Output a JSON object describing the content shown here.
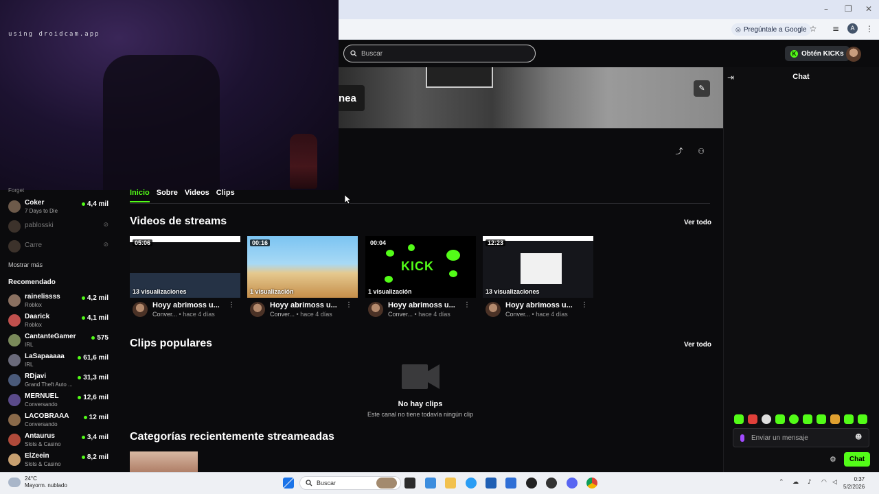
{
  "browser": {
    "ask_google": "Pregúntale a Google",
    "profile_initial": "A"
  },
  "header": {
    "search_placeholder": "Buscar",
    "get_kicks": "Obtén KICKs"
  },
  "banner": {
    "label_fragment": "nea"
  },
  "webcam": {
    "overlay_text": "using droidcam.app"
  },
  "chat": {
    "title": "Chat",
    "input_placeholder": "Enviar un mensaje",
    "send_label": "Chat"
  },
  "sidebar": {
    "partial_top": "Forget",
    "following": [
      {
        "name": "Coker",
        "game": "7 Days to Die",
        "viewers": "4,4 mil",
        "live": true
      },
      {
        "name": "pablosski",
        "live": false
      },
      {
        "name": "Carre",
        "live": false
      }
    ],
    "show_more": "Mostrar más",
    "recommended_title": "Recomendado",
    "recommended": [
      {
        "name": "rainelissss",
        "game": "Roblox",
        "viewers": "4,2 mil"
      },
      {
        "name": "Daarick",
        "game": "Roblox",
        "viewers": "4,1 mil"
      },
      {
        "name": "CantanteGamer",
        "game": "IRL",
        "viewers": "575"
      },
      {
        "name": "LaSapaaaaa",
        "game": "IRL",
        "viewers": "61,6 mil"
      },
      {
        "name": "RDjavi",
        "game": "Grand Theft Auto ...",
        "viewers": "31,3 mil"
      },
      {
        "name": "MERNUEL",
        "game": "Conversando",
        "viewers": "12,6 mil"
      },
      {
        "name": "LACOBRAAA",
        "game": "Conversando",
        "viewers": "12 mil"
      },
      {
        "name": "Antaurus",
        "game": "Slots & Casino",
        "viewers": "3,4 mil"
      },
      {
        "name": "ElZeein",
        "game": "Slots & Casino",
        "viewers": "8,2 mil"
      }
    ]
  },
  "tabs": [
    "Inicio",
    "Sobre",
    "Videos",
    "Clips"
  ],
  "videos_section": {
    "title": "Videos de streams",
    "see_all": "Ver todo",
    "videos": [
      {
        "duration": "05:06",
        "views": "13 visualizaciones",
        "title": "Hoyy abrimoss u...",
        "channel": "Conver...",
        "age": "• hace 4 días"
      },
      {
        "duration": "00:16",
        "views": "1 visualización",
        "title": "Hoyy abrimoss u...",
        "channel": "Conver...",
        "age": "• hace 4 días"
      },
      {
        "duration": "00:04",
        "views": "1 visualización",
        "title": "Hoyy abrimoss u...",
        "channel": "Conver...",
        "age": "• hace 4 días"
      },
      {
        "duration": "12:23",
        "views": "13 visualizaciones",
        "title": "Hoyy abrimoss u...",
        "channel": "Conver...",
        "age": "• hace 4 días"
      }
    ],
    "kick_logo_text": "KICK"
  },
  "clips_section": {
    "title": "Clips populares",
    "see_all": "Ver todo",
    "empty_title": "No hay clips",
    "empty_sub": "Este canal no tiene todavía ningún clip"
  },
  "categories_section": {
    "title": "Categorías recientemente streameadas"
  },
  "taskbar": {
    "weather_temp": "24°C",
    "weather_desc": "Mayorm. nublado",
    "search_label": "Buscar",
    "time": "0:37",
    "date": "5/2/2026"
  },
  "colors": {
    "accent": "#53fc18",
    "background": "#0b0b0d"
  }
}
